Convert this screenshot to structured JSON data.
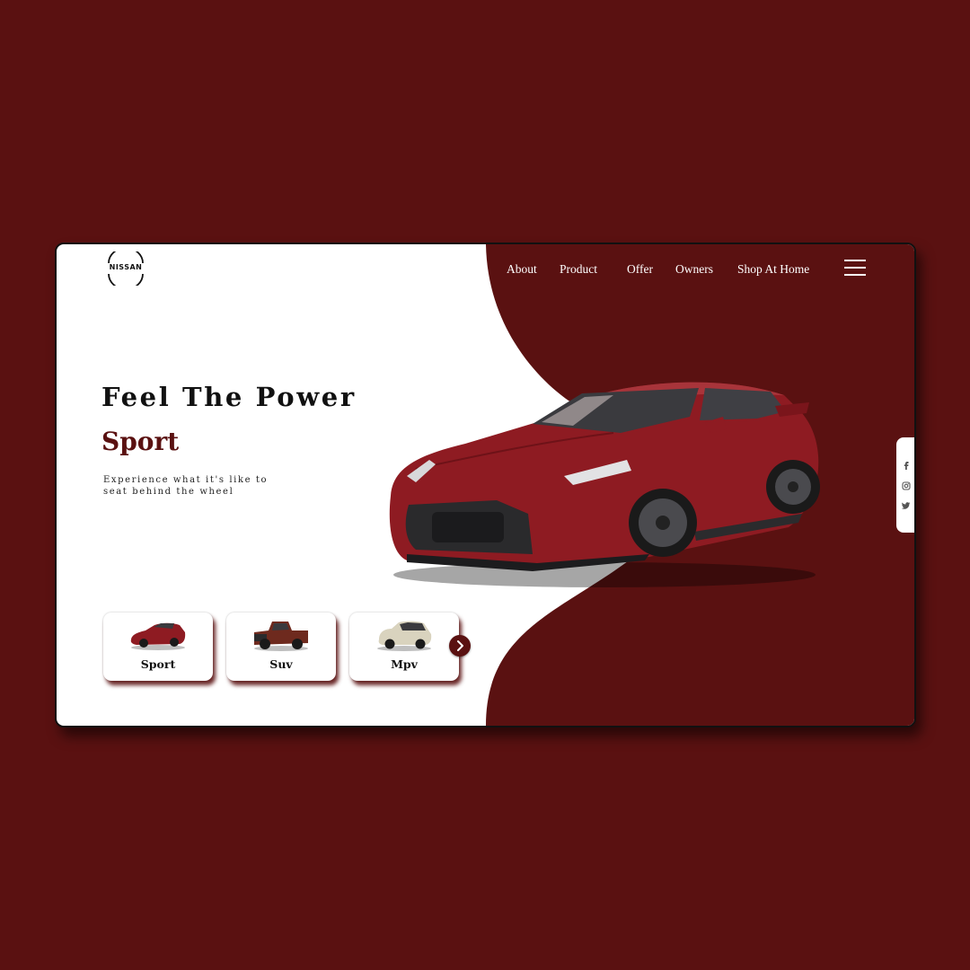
{
  "brand": {
    "name": "NISSAN"
  },
  "nav": {
    "items": [
      {
        "label": "About"
      },
      {
        "label": "Product"
      },
      {
        "label": "Offer"
      },
      {
        "label": "Owners"
      },
      {
        "label": "Shop At Home"
      }
    ],
    "menu_icon": "hamburger-menu-icon"
  },
  "hero": {
    "headline": "Feel The Power",
    "subheadline": "Sport",
    "tagline": "Experience what it's like to seat behind the wheel"
  },
  "categories": [
    {
      "label": "Sport",
      "icon": "sport-car-icon"
    },
    {
      "label": "Suv",
      "icon": "suv-truck-icon"
    },
    {
      "label": "Mpv",
      "icon": "mpv-car-icon"
    }
  ],
  "next_icon": "chevron-right-icon",
  "social": [
    {
      "icon": "facebook-icon"
    },
    {
      "icon": "instagram-icon"
    },
    {
      "icon": "twitter-icon"
    }
  ],
  "colors": {
    "brand": "#5a1111",
    "car_body": "#8e1b22",
    "mpv_body": "#d9d3be",
    "background": "#ffffff"
  }
}
